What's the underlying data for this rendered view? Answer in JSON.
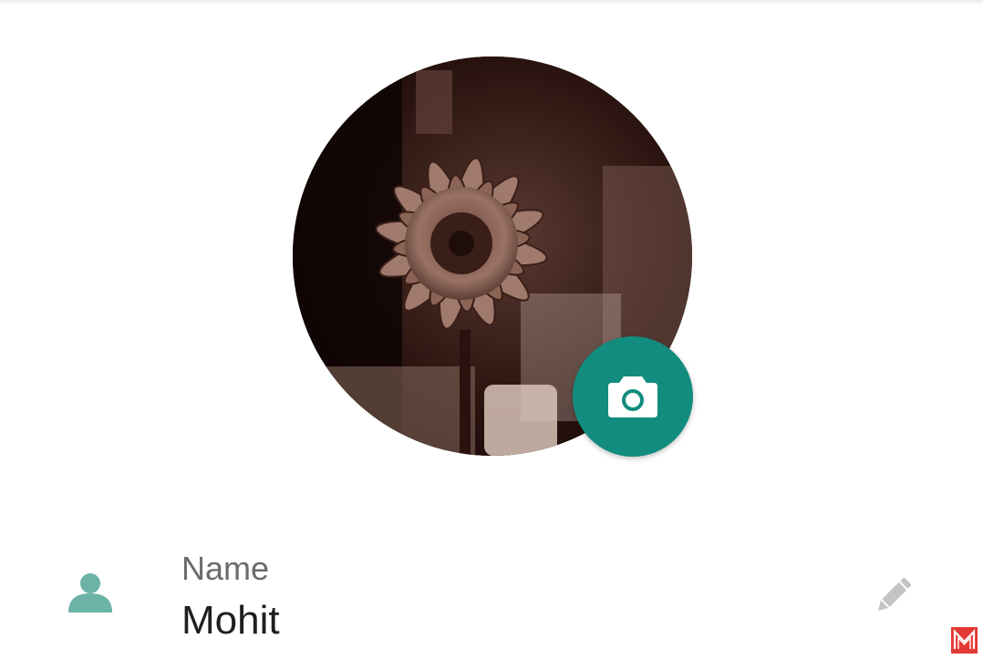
{
  "profile": {
    "photo_icon": "profile-photo",
    "camera_icon": "camera-icon",
    "accent_color": "#128c7e"
  },
  "name_row": {
    "label": "Name",
    "value": "Mohit",
    "person_icon": "person-icon",
    "edit_icon": "pencil-icon",
    "icon_color": "#6cb3a7"
  },
  "watermark": {
    "text": "M",
    "color": "#e53935"
  }
}
